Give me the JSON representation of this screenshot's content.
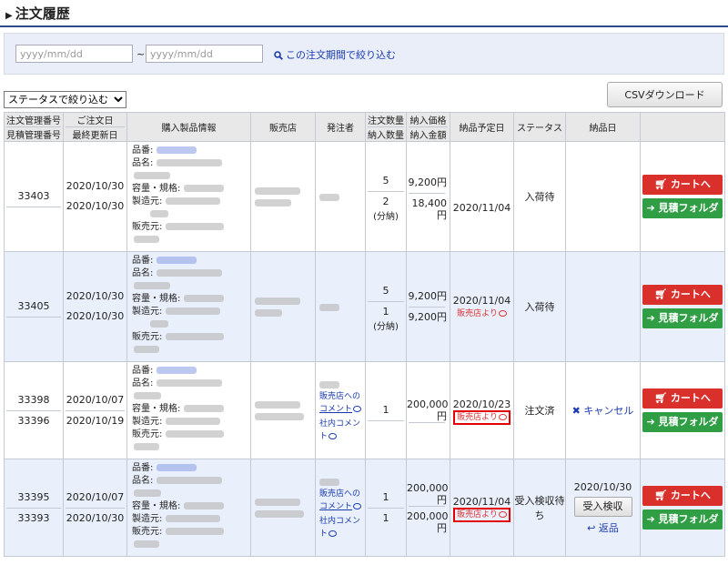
{
  "page": {
    "title": "注文履歴"
  },
  "filter": {
    "date_from_placeholder": "yyyy/mm/dd",
    "date_to_placeholder": "yyyy/mm/dd",
    "tilde": "~",
    "apply_link": "この注文期間で絞り込む",
    "status_select": "ステータスで絞り込む",
    "csv_button": "CSVダウンロード"
  },
  "headers": {
    "order_no": "注文管理番号",
    "quote_no": "見積管理番号",
    "order_date": "ご注文日",
    "updated_date": "最終更新日",
    "product_info": "購入製品情報",
    "shop": "販売店",
    "orderer": "発注者",
    "order_qty": "注文数量",
    "delivered_qty": "納入数量",
    "unit_price": "納入価格",
    "amount": "納入金額",
    "due_date": "納品予定日",
    "status": "ステータス",
    "delivered_date": "納品日"
  },
  "labels": {
    "product_no": "品番:",
    "product_name": "品名:",
    "capacity": "容量・規格:",
    "maker": "製造元:",
    "seller": "販売元:",
    "cart_button": "カートへ",
    "estimate_button": "見積フォルダ",
    "from_shop": "販売店より",
    "comment_to_shop": "販売店への",
    "comment_word": "コメント",
    "internal_comment": "社内コメント",
    "cancel": "キャンセル",
    "inspect_button": "受入検収",
    "return_link": "返品",
    "split_delivery": "(分納)"
  },
  "rows": [
    {
      "order_no": "33403",
      "quote_no": "",
      "order_date": "2020/10/30",
      "updated_date": "2020/10/30",
      "order_qty": "5",
      "delivered_qty": "2",
      "unit_price": "9,200円",
      "amount_a": "18,400",
      "amount_b": "円",
      "due_date": "2020/11/04",
      "status": "入荷待",
      "delivered_date": ""
    },
    {
      "order_no": "33405",
      "quote_no": "",
      "order_date": "2020/10/30",
      "updated_date": "2020/10/30",
      "order_qty": "5",
      "delivered_qty": "1",
      "unit_price": "9,200円",
      "amount": "9,200円",
      "due_date": "2020/11/04",
      "status": "入荷待",
      "delivered_date": ""
    },
    {
      "order_no": "33398",
      "quote_no": "33396",
      "order_date": "2020/10/07",
      "updated_date": "2020/10/19",
      "order_qty": "1",
      "delivered_qty": "",
      "unit_price_a": "200,000",
      "unit_price_b": "円",
      "due_date": "2020/10/23",
      "status": "注文済",
      "delivered_date": ""
    },
    {
      "order_no": "33395",
      "quote_no": "33393",
      "order_date": "2020/10/07",
      "updated_date": "2020/10/30",
      "order_qty": "1",
      "delivered_qty": "1",
      "unit_price_a": "200,000",
      "unit_price_b": "円",
      "amount_a": "200,000",
      "amount_b": "円",
      "due_date": "2020/11/04",
      "status": "受入検収待ち",
      "delivered_date": "2020/10/30"
    }
  ],
  "colors": {
    "accent_blue": "#1a3bb0",
    "cart_red": "#d9302c",
    "estimate_green": "#2f9e44",
    "highlight_red": "#e20000"
  }
}
